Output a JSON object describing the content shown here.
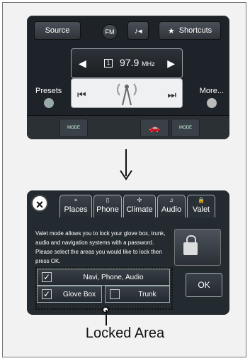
{
  "radio": {
    "source_label": "Source",
    "fm_label": "FM",
    "shortcuts_label": "Shortcuts",
    "channel": "1",
    "frequency": "97.9",
    "unit": "MHz",
    "presets_label": "Presets",
    "more_label": "More...",
    "mode_label": "MODE"
  },
  "valet": {
    "tabs": [
      {
        "label": "Places",
        "icon": "compass-icon"
      },
      {
        "label": "Phone",
        "icon": "phone-icon"
      },
      {
        "label": "Climate",
        "icon": "fan-icon"
      },
      {
        "label": "Audio",
        "icon": "music-icon"
      },
      {
        "label": "Valet",
        "icon": "lock-icon"
      }
    ],
    "description": "Valet mode allows you to lock your glove box, trunk, audio and navigation systems with a password. Please select the areas you would like to lock then press OK.",
    "options": [
      {
        "label": "Navi, Phone, Audio",
        "checked": true
      },
      {
        "label": "Glove Box",
        "checked": true
      },
      {
        "label": "Trunk",
        "checked": false
      }
    ],
    "ok_label": "OK"
  },
  "callout": "Locked Area"
}
